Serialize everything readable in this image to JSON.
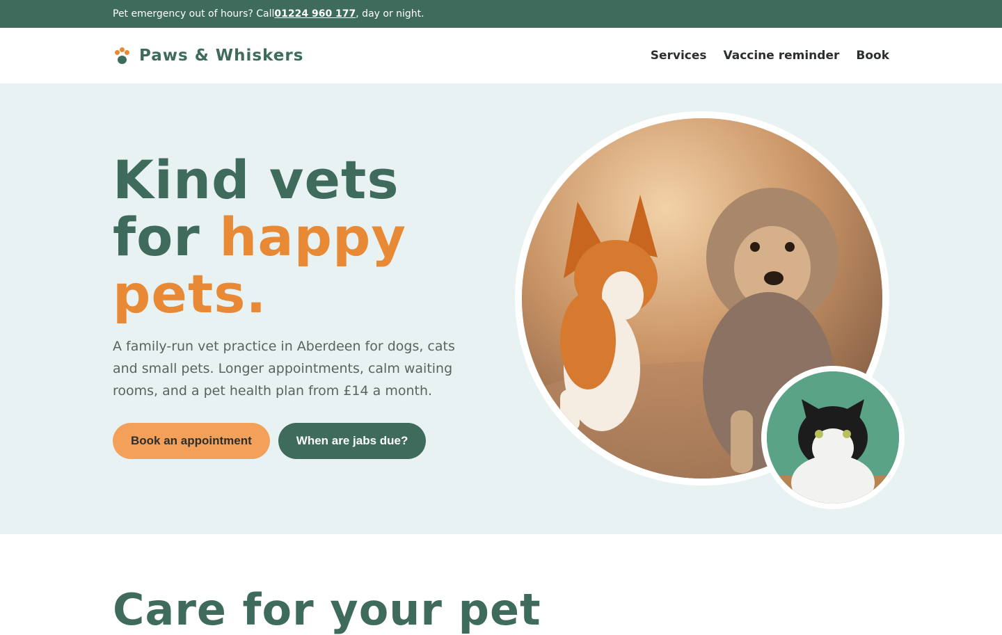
{
  "topbar": {
    "prefix": "Pet emergency out of hours? Call ",
    "phone": "01224 960 177",
    "suffix": ", day or night."
  },
  "brand": {
    "name": "Paws & Whiskers"
  },
  "nav": {
    "items": [
      "Services",
      "Vaccine reminder",
      "Book"
    ]
  },
  "hero": {
    "headline_line1": "Kind vets",
    "headline_line2_plain": "for ",
    "headline_line2_accent": "happy",
    "headline_line3_accent": "pets.",
    "lede": "A family-run vet practice in Aberdeen for dogs, cats and small pets. Longer appointments, calm waiting rooms, and a pet health plan from £14 a month.",
    "primary_button": "Book an appointment",
    "secondary_button": "When are jabs due?"
  },
  "section2": {
    "title": "Care for your pet"
  },
  "colors": {
    "brand_green": "#3e6b5b",
    "accent_orange": "#e88a35",
    "button_orange": "#f3a15a",
    "hero_bg": "#e8f2f2"
  }
}
